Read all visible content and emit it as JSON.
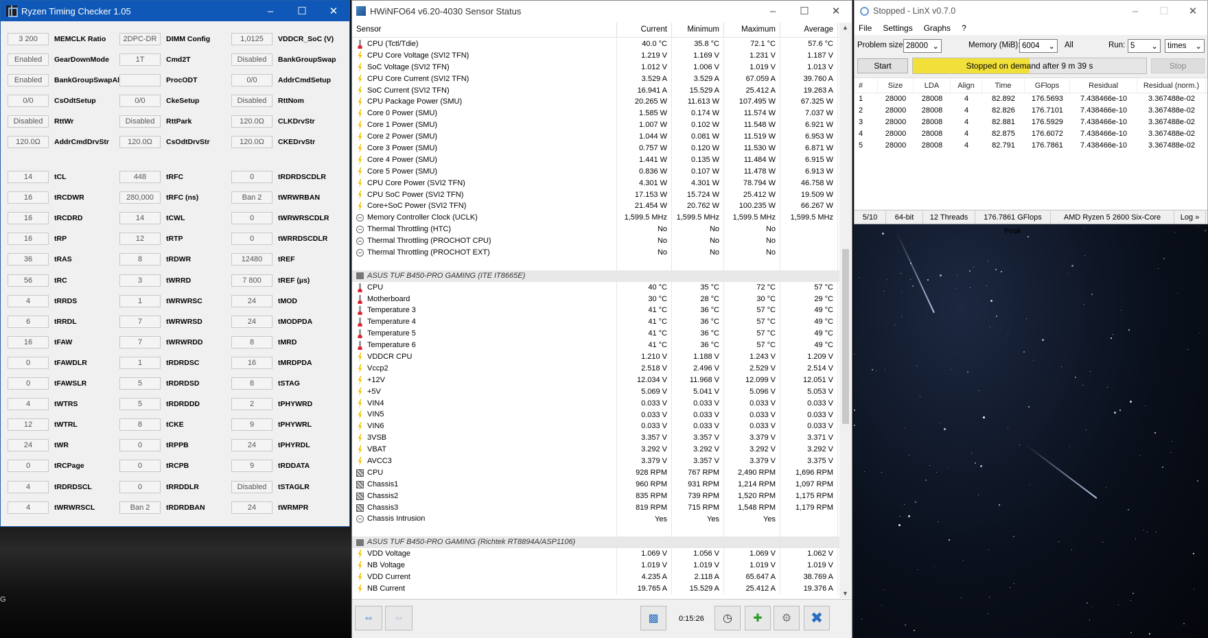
{
  "rtc": {
    "title": "Ryzen Timing Checker 1.05",
    "col1": [
      {
        "value": "3 200",
        "label": "MEMCLK Ratio"
      },
      {
        "value": "Enabled",
        "label": "GearDownMode"
      },
      {
        "value": "Enabled",
        "label": "BankGroupSwapAlt"
      },
      {
        "value": "0/0",
        "label": "CsOdtSetup"
      },
      {
        "value": "Disabled",
        "label": "RttWr"
      },
      {
        "value": "120.0Ω",
        "label": "AddrCmdDrvStr"
      },
      {
        "value": "14",
        "label": "tCL"
      },
      {
        "value": "16",
        "label": "tRCDWR"
      },
      {
        "value": "16",
        "label": "tRCDRD"
      },
      {
        "value": "16",
        "label": "tRP"
      },
      {
        "value": "36",
        "label": "tRAS"
      },
      {
        "value": "56",
        "label": "tRC"
      },
      {
        "value": "4",
        "label": "tRRDS"
      },
      {
        "value": "6",
        "label": "tRRDL"
      },
      {
        "value": "16",
        "label": "tFAW"
      },
      {
        "value": "0",
        "label": "tFAWDLR"
      },
      {
        "value": "0",
        "label": "tFAWSLR"
      },
      {
        "value": "4",
        "label": "tWTRS"
      },
      {
        "value": "12",
        "label": "tWTRL"
      },
      {
        "value": "24",
        "label": "tWR"
      },
      {
        "value": "0",
        "label": "tRCPage"
      },
      {
        "value": "4",
        "label": "tRDRDSCL"
      },
      {
        "value": "4",
        "label": "tWRWRSCL"
      }
    ],
    "col2": [
      {
        "value": "2DPC-DR",
        "label": "DIMM Config"
      },
      {
        "value": "1T",
        "label": "Cmd2T"
      },
      {
        "value": "",
        "label": "ProcODT"
      },
      {
        "value": "0/0",
        "label": "CkeSetup"
      },
      {
        "value": "Disabled",
        "label": "RttPark"
      },
      {
        "value": "120.0Ω",
        "label": "CsOdtDrvStr"
      },
      {
        "value": "448",
        "label": "tRFC"
      },
      {
        "value": "280,000",
        "label": "tRFC (ns)"
      },
      {
        "value": "14",
        "label": "tCWL"
      },
      {
        "value": "12",
        "label": "tRTP"
      },
      {
        "value": "8",
        "label": "tRDWR"
      },
      {
        "value": "3",
        "label": "tWRRD"
      },
      {
        "value": "1",
        "label": "tWRWRSC"
      },
      {
        "value": "7",
        "label": "tWRWRSD"
      },
      {
        "value": "7",
        "label": "tWRWRDD"
      },
      {
        "value": "1",
        "label": "tRDRDSC"
      },
      {
        "value": "5",
        "label": "tRDRDSD"
      },
      {
        "value": "5",
        "label": "tRDRDDD"
      },
      {
        "value": "8",
        "label": "tCKE"
      },
      {
        "value": "0",
        "label": "tRPPB"
      },
      {
        "value": "0",
        "label": "tRCPB"
      },
      {
        "value": "0",
        "label": "tRRDDLR"
      },
      {
        "value": "Ban 2",
        "label": "tRDRDBAN"
      }
    ],
    "col3": [
      {
        "value": "1,0125",
        "label": "VDDCR_SoC (V)"
      },
      {
        "value": "Disabled",
        "label": "BankGroupSwap"
      },
      {
        "value": "0/0",
        "label": "AddrCmdSetup"
      },
      {
        "value": "Disabled",
        "label": "RttNom"
      },
      {
        "value": "120.0Ω",
        "label": "CLKDrvStr"
      },
      {
        "value": "120.0Ω",
        "label": "CKEDrvStr"
      },
      {
        "value": "0",
        "label": "tRDRDSCDLR"
      },
      {
        "value": "Ban 2",
        "label": "tWRWRBAN"
      },
      {
        "value": "0",
        "label": "tWRWRSCDLR"
      },
      {
        "value": "0",
        "label": "tWRRDSCDLR"
      },
      {
        "value": "12480",
        "label": "tREF"
      },
      {
        "value": "7 800",
        "label": "tREF (µs)"
      },
      {
        "value": "24",
        "label": "tMOD"
      },
      {
        "value": "24",
        "label": "tMODPDA"
      },
      {
        "value": "8",
        "label": "tMRD"
      },
      {
        "value": "16",
        "label": "tMRDPDA"
      },
      {
        "value": "8",
        "label": "tSTAG"
      },
      {
        "value": "2",
        "label": "tPHYWRD"
      },
      {
        "value": "9",
        "label": "tPHYWRL"
      },
      {
        "value": "24",
        "label": "tPHYRDL"
      },
      {
        "value": "9",
        "label": "tRDDATA"
      },
      {
        "value": "Disabled",
        "label": "tSTAGLR"
      },
      {
        "value": "24",
        "label": "tWRMPR"
      }
    ]
  },
  "hw": {
    "title": "HWiNFO64 v6.20-4030 Sensor Status",
    "headers": [
      "Sensor",
      "Current",
      "Minimum",
      "Maximum",
      "Average"
    ],
    "rows": [
      {
        "icon": "t",
        "name": "CPU (Tctl/Tdie)",
        "cur": "40.0 °C",
        "min": "35.8 °C",
        "max": "72.1 °C",
        "avg": "57.6 °C"
      },
      {
        "icon": "v",
        "name": "CPU Core Voltage (SVI2 TFN)",
        "cur": "1.219 V",
        "min": "1.169 V",
        "max": "1.231 V",
        "avg": "1.187 V"
      },
      {
        "icon": "v",
        "name": "SoC Voltage (SVI2 TFN)",
        "cur": "1.012 V",
        "min": "1.006 V",
        "max": "1.019 V",
        "avg": "1.013 V"
      },
      {
        "icon": "v",
        "name": "CPU Core Current (SVI2 TFN)",
        "cur": "3.529 A",
        "min": "3.529 A",
        "max": "67.059 A",
        "avg": "39.760 A"
      },
      {
        "icon": "v",
        "name": "SoC Current (SVI2 TFN)",
        "cur": "16.941 A",
        "min": "15.529 A",
        "max": "25.412 A",
        "avg": "19.263 A"
      },
      {
        "icon": "v",
        "name": "CPU Package Power (SMU)",
        "cur": "20.265 W",
        "min": "11.613 W",
        "max": "107.495 W",
        "avg": "67.325 W"
      },
      {
        "icon": "v",
        "name": "Core 0 Power (SMU)",
        "cur": "1.585 W",
        "min": "0.174 W",
        "max": "11.574 W",
        "avg": "7.037 W"
      },
      {
        "icon": "v",
        "name": "Core 1 Power (SMU)",
        "cur": "1.007 W",
        "min": "0.102 W",
        "max": "11.548 W",
        "avg": "6.921 W"
      },
      {
        "icon": "v",
        "name": "Core 2 Power (SMU)",
        "cur": "1.044 W",
        "min": "0.081 W",
        "max": "11.519 W",
        "avg": "6.953 W"
      },
      {
        "icon": "v",
        "name": "Core 3 Power (SMU)",
        "cur": "0.757 W",
        "min": "0.120 W",
        "max": "11.530 W",
        "avg": "6.871 W"
      },
      {
        "icon": "v",
        "name": "Core 4 Power (SMU)",
        "cur": "1.441 W",
        "min": "0.135 W",
        "max": "11.484 W",
        "avg": "6.915 W"
      },
      {
        "icon": "v",
        "name": "Core 5 Power (SMU)",
        "cur": "0.836 W",
        "min": "0.107 W",
        "max": "11.478 W",
        "avg": "6.913 W"
      },
      {
        "icon": "v",
        "name": "CPU Core Power (SVI2 TFN)",
        "cur": "4.301 W",
        "min": "4.301 W",
        "max": "78.794 W",
        "avg": "46.758 W"
      },
      {
        "icon": "v",
        "name": "CPU SoC Power (SVI2 TFN)",
        "cur": "17.153 W",
        "min": "15.724 W",
        "max": "25.412 W",
        "avg": "19.509 W"
      },
      {
        "icon": "v",
        "name": "Core+SoC Power (SVI2 TFN)",
        "cur": "21.454 W",
        "min": "20.762 W",
        "max": "100.235 W",
        "avg": "66.267 W"
      },
      {
        "icon": "c",
        "name": "Memory Controller Clock (UCLK)",
        "cur": "1,599.5 MHz",
        "min": "1,599.5 MHz",
        "max": "1,599.5 MHz",
        "avg": "1,599.5 MHz"
      },
      {
        "icon": "c",
        "name": "Thermal Throttling (HTC)",
        "cur": "No",
        "min": "No",
        "max": "No",
        "avg": ""
      },
      {
        "icon": "c",
        "name": "Thermal Throttling (PROCHOT CPU)",
        "cur": "No",
        "min": "No",
        "max": "No",
        "avg": ""
      },
      {
        "icon": "c",
        "name": "Thermal Throttling (PROCHOT EXT)",
        "cur": "No",
        "min": "No",
        "max": "No",
        "avg": ""
      },
      {
        "icon": "",
        "name": "",
        "cur": "",
        "min": "",
        "max": "",
        "avg": ""
      },
      {
        "icon": "g",
        "group": true,
        "name": "ASUS TUF B450-PRO GAMING (ITE IT8665E)",
        "cur": "",
        "min": "",
        "max": "",
        "avg": ""
      },
      {
        "icon": "t",
        "name": "CPU",
        "cur": "40 °C",
        "min": "35 °C",
        "max": "72 °C",
        "avg": "57 °C"
      },
      {
        "icon": "t",
        "name": "Motherboard",
        "cur": "30 °C",
        "min": "28 °C",
        "max": "30 °C",
        "avg": "29 °C"
      },
      {
        "icon": "t",
        "name": "Temperature 3",
        "cur": "41 °C",
        "min": "36 °C",
        "max": "57 °C",
        "avg": "49 °C"
      },
      {
        "icon": "t",
        "name": "Temperature 4",
        "cur": "41 °C",
        "min": "36 °C",
        "max": "57 °C",
        "avg": "49 °C"
      },
      {
        "icon": "t",
        "name": "Temperature 5",
        "cur": "41 °C",
        "min": "36 °C",
        "max": "57 °C",
        "avg": "49 °C"
      },
      {
        "icon": "t",
        "name": "Temperature 6",
        "cur": "41 °C",
        "min": "36 °C",
        "max": "57 °C",
        "avg": "49 °C"
      },
      {
        "icon": "v",
        "name": "VDDCR CPU",
        "cur": "1.210 V",
        "min": "1.188 V",
        "max": "1.243 V",
        "avg": "1.209 V"
      },
      {
        "icon": "v",
        "name": "Vccp2",
        "cur": "2.518 V",
        "min": "2.496 V",
        "max": "2.529 V",
        "avg": "2.514 V"
      },
      {
        "icon": "v",
        "name": "+12V",
        "cur": "12.034 V",
        "min": "11.968 V",
        "max": "12.099 V",
        "avg": "12.051 V"
      },
      {
        "icon": "v",
        "name": "+5V",
        "cur": "5.069 V",
        "min": "5.041 V",
        "max": "5.096 V",
        "avg": "5.053 V"
      },
      {
        "icon": "v",
        "name": "VIN4",
        "cur": "0.033 V",
        "min": "0.033 V",
        "max": "0.033 V",
        "avg": "0.033 V"
      },
      {
        "icon": "v",
        "name": "VIN5",
        "cur": "0.033 V",
        "min": "0.033 V",
        "max": "0.033 V",
        "avg": "0.033 V"
      },
      {
        "icon": "v",
        "name": "VIN6",
        "cur": "0.033 V",
        "min": "0.033 V",
        "max": "0.033 V",
        "avg": "0.033 V"
      },
      {
        "icon": "v",
        "name": "3VSB",
        "cur": "3.357 V",
        "min": "3.357 V",
        "max": "3.379 V",
        "avg": "3.371 V"
      },
      {
        "icon": "v",
        "name": "VBAT",
        "cur": "3.292 V",
        "min": "3.292 V",
        "max": "3.292 V",
        "avg": "3.292 V"
      },
      {
        "icon": "v",
        "name": "AVCC3",
        "cur": "3.379 V",
        "min": "3.357 V",
        "max": "3.379 V",
        "avg": "3.375 V"
      },
      {
        "icon": "f",
        "name": "CPU",
        "cur": "928 RPM",
        "min": "767 RPM",
        "max": "2,490 RPM",
        "avg": "1,696 RPM"
      },
      {
        "icon": "f",
        "name": "Chassis1",
        "cur": "960 RPM",
        "min": "931 RPM",
        "max": "1,214 RPM",
        "avg": "1,097 RPM"
      },
      {
        "icon": "f",
        "name": "Chassis2",
        "cur": "835 RPM",
        "min": "739 RPM",
        "max": "1,520 RPM",
        "avg": "1,175 RPM"
      },
      {
        "icon": "f",
        "name": "Chassis3",
        "cur": "819 RPM",
        "min": "715 RPM",
        "max": "1,548 RPM",
        "avg": "1,179 RPM"
      },
      {
        "icon": "c",
        "name": "Chassis Intrusion",
        "cur": "Yes",
        "min": "Yes",
        "max": "Yes",
        "avg": ""
      },
      {
        "icon": "",
        "name": "",
        "cur": "",
        "min": "",
        "max": "",
        "avg": ""
      },
      {
        "icon": "g",
        "group": true,
        "name": "ASUS TUF B450-PRO GAMING (Richtek RT8894A/ASP1106)",
        "cur": "",
        "min": "",
        "max": "",
        "avg": ""
      },
      {
        "icon": "v",
        "name": "VDD Voltage",
        "cur": "1.069 V",
        "min": "1.056 V",
        "max": "1.069 V",
        "avg": "1.062 V"
      },
      {
        "icon": "v",
        "name": "NB Voltage",
        "cur": "1.019 V",
        "min": "1.019 V",
        "max": "1.019 V",
        "avg": "1.019 V"
      },
      {
        "icon": "v",
        "name": "VDD Current",
        "cur": "4.235 A",
        "min": "2.118 A",
        "max": "65.647 A",
        "avg": "38.769 A"
      },
      {
        "icon": "v",
        "name": "NB Current",
        "cur": "19.765 A",
        "min": "15.529 A",
        "max": "25.412 A",
        "avg": "19.376 A"
      }
    ],
    "elapsed": "0:15:26"
  },
  "lx": {
    "title": "Stopped - LinX v0.7.0",
    "menu": [
      "File",
      "Settings",
      "Graphs",
      "?"
    ],
    "problem_size_label": "Problem size:",
    "problem_size": "28000",
    "memory_label": "Memory (MiB):",
    "memory": "6004",
    "all_label": "All",
    "run_label": "Run:",
    "run": "5",
    "run_unit": "times",
    "start": "Start",
    "stop": "Stop",
    "progress_fraction": 0.5,
    "progress_text": "Stopped on demand after 9 m 39 s",
    "headers": [
      "#",
      "Size",
      "LDA",
      "Align",
      "Time",
      "GFlops",
      "Residual",
      "Residual (norm.)"
    ],
    "rows": [
      [
        "1",
        "28000",
        "28008",
        "4",
        "82.892",
        "176.5693",
        "7.438466e-10",
        "3.367488e-02"
      ],
      [
        "2",
        "28000",
        "28008",
        "4",
        "82.826",
        "176.7101",
        "7.438466e-10",
        "3.367488e-02"
      ],
      [
        "3",
        "28000",
        "28008",
        "4",
        "82.881",
        "176.5929",
        "7.438466e-10",
        "3.367488e-02"
      ],
      [
        "4",
        "28000",
        "28008",
        "4",
        "82.875",
        "176.6072",
        "7.438466e-10",
        "3.367488e-02"
      ],
      [
        "5",
        "28000",
        "28008",
        "4",
        "82.791",
        "176.7861",
        "7.438466e-10",
        "3.367488e-02"
      ]
    ],
    "status": [
      "5/10",
      "64-bit",
      "12 Threads",
      "176.7861 GFlops Peak",
      "AMD Ryzen 5 2600 Six-Core",
      "Log »"
    ]
  },
  "desktop": {
    "left_text": "G"
  }
}
